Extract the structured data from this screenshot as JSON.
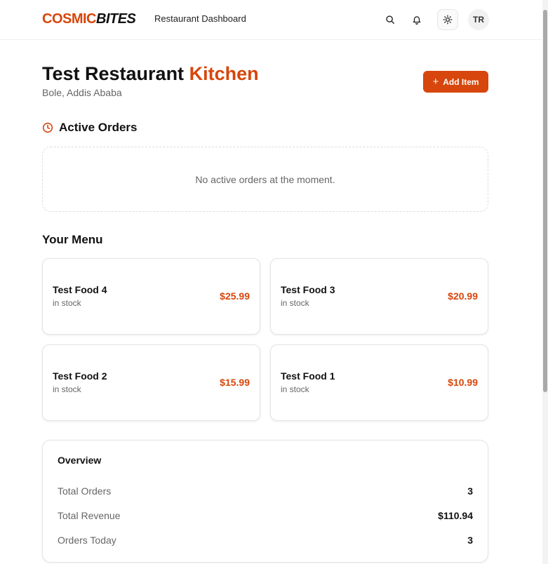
{
  "header": {
    "logo_part1": "COSMIC",
    "logo_part2": "BITES",
    "nav_title": "Restaurant Dashboard",
    "icons": [
      "search-icon",
      "bell-icon",
      "sun-icon"
    ],
    "avatar_initials": "TR"
  },
  "restaurant": {
    "name": "Test Restaurant",
    "name_accent": "Kitchen",
    "location": "Bole, Addis Ababa",
    "add_button_label": "Add Item"
  },
  "active_orders": {
    "title": "Active Orders",
    "empty_message": "No active orders at the moment."
  },
  "menu": {
    "title": "Your Menu",
    "items": [
      {
        "name": "Test Food 4",
        "status": "in stock",
        "price": "$25.99"
      },
      {
        "name": "Test Food 3",
        "status": "in stock",
        "price": "$20.99"
      },
      {
        "name": "Test Food 2",
        "status": "in stock",
        "price": "$15.99"
      },
      {
        "name": "Test Food 1",
        "status": "in stock",
        "price": "$10.99"
      }
    ]
  },
  "overview": {
    "title": "Overview",
    "rows": [
      {
        "label": "Total Orders",
        "value": "3"
      },
      {
        "label": "Total Revenue",
        "value": "$110.94"
      },
      {
        "label": "Orders Today",
        "value": "3"
      }
    ]
  },
  "colors": {
    "accent": "#d7460c",
    "text": "#111111",
    "muted": "#666666"
  }
}
